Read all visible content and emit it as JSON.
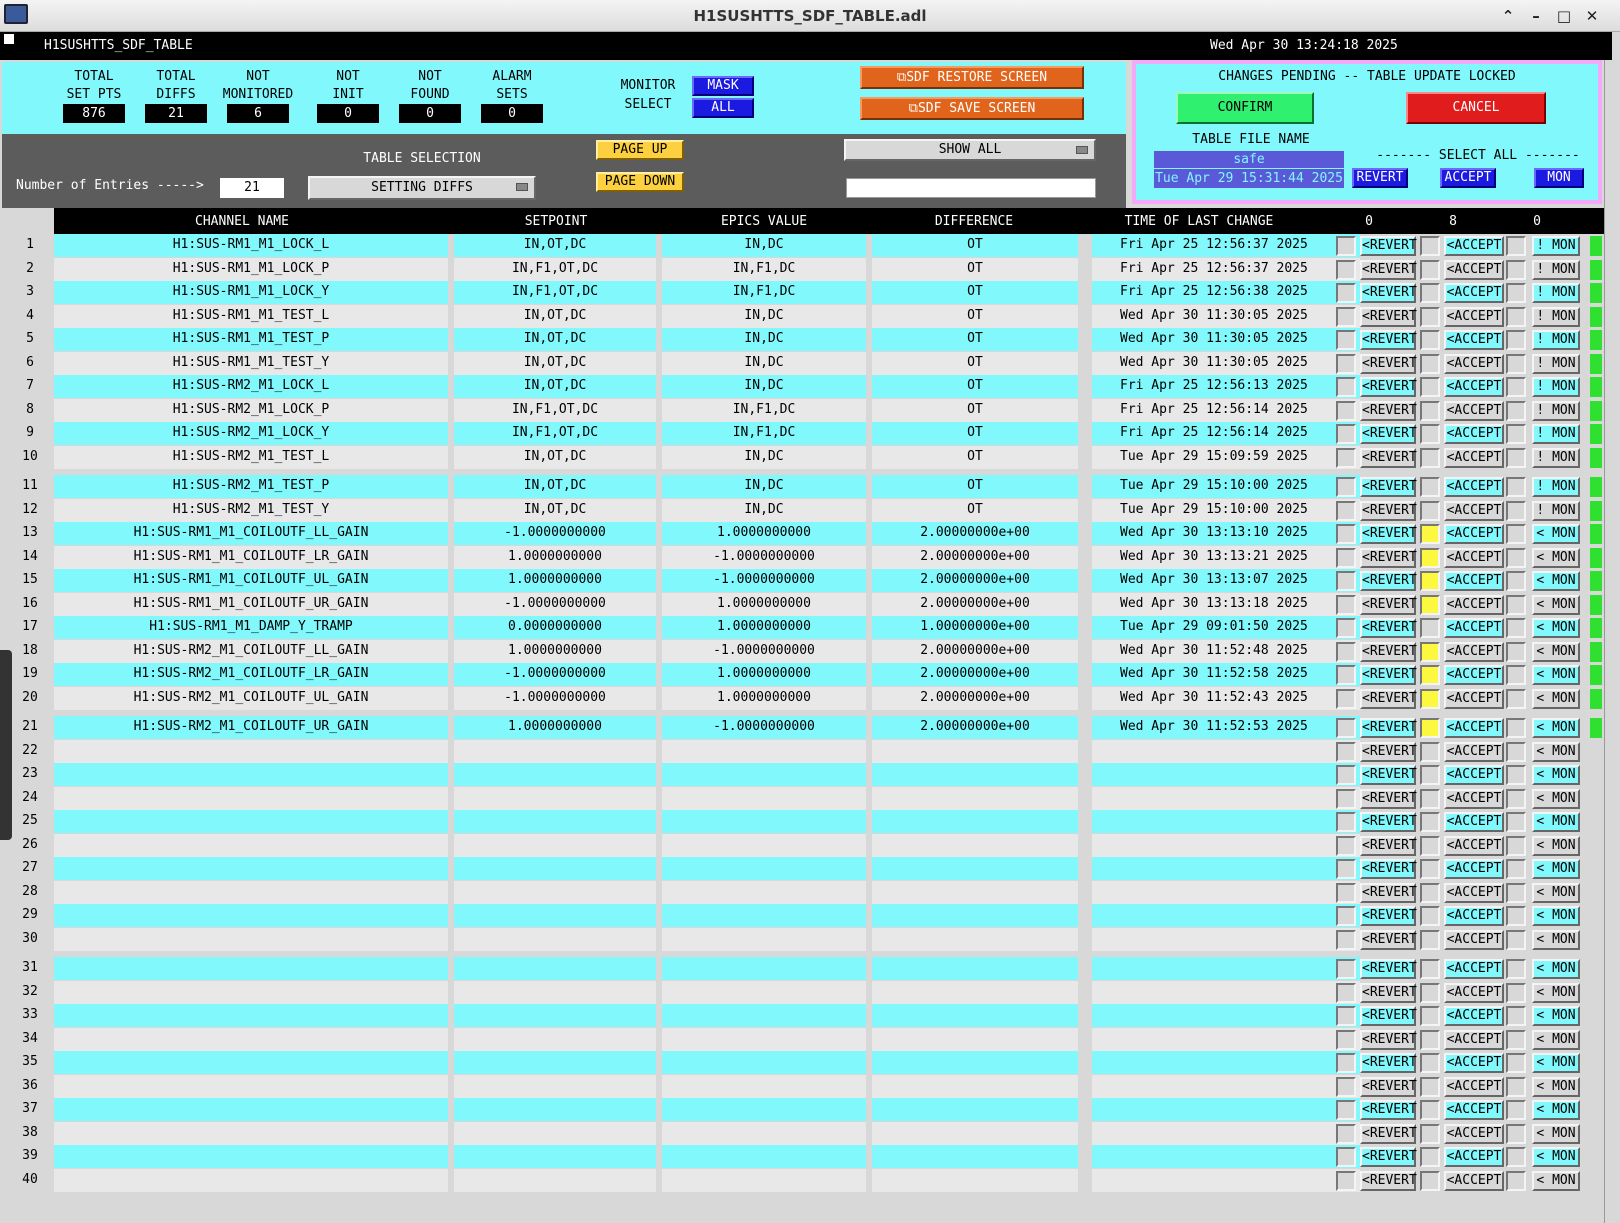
{
  "window": {
    "title": "H1SUSHTTS_SDF_TABLE.adl"
  },
  "header": {
    "screen_name": "H1SUSHTTS_SDF_TABLE",
    "timestamp": "Wed Apr 30 13:24:18 2025"
  },
  "summary": {
    "stats": [
      {
        "label1": "TOTAL",
        "label2": "SET PTS",
        "value": "876"
      },
      {
        "label1": "TOTAL",
        "label2": "DIFFS",
        "value": "21"
      },
      {
        "label1": "NOT",
        "label2": "MONITORED",
        "value": "6"
      },
      {
        "label1": "NOT",
        "label2": "INIT",
        "value": "0"
      },
      {
        "label1": "NOT",
        "label2": "FOUND",
        "value": "0"
      },
      {
        "label1": "ALARM",
        "label2": "SETS",
        "value": "0"
      }
    ],
    "monitor_select_1": "MONITOR",
    "monitor_select_2": "SELECT",
    "mask_label": "MASK",
    "all_label": "ALL",
    "restore_label": "SDF RESTORE SCREEN",
    "save_label": "SDF SAVE SCREEN"
  },
  "pending": {
    "title": "CHANGES PENDING -- TABLE UPDATE LOCKED",
    "confirm": "CONFIRM",
    "cancel": "CANCEL",
    "file_name_label": "TABLE FILE NAME",
    "file_name": "safe",
    "file_date": "Tue Apr 29 15:31:44 2025",
    "select_all": "------- SELECT ALL -------",
    "revert": "REVERT",
    "accept": "ACCEPT",
    "mon": "MON"
  },
  "controls": {
    "table_selection_label": "TABLE SELECTION",
    "table_selection_value": "SETTING DIFFS",
    "entries_label": "Number of Entries ----->",
    "entries_value": "21",
    "page_up": "PAGE UP",
    "page_down": "PAGE DOWN",
    "show_all": "SHOW ALL",
    "filter_value": ""
  },
  "table": {
    "columns": {
      "channel": "CHANNEL NAME",
      "setpoint": "SETPOINT",
      "epics": "EPICS VALUE",
      "difference": "DIFFERENCE",
      "time": "TIME OF LAST CHANGE",
      "revert_count": "0",
      "accept_count": "8",
      "mon_count": "0"
    },
    "revert_label": "<REVERT",
    "accept_label": "<ACCEPT",
    "rows": [
      {
        "n": "1",
        "channel": "H1:SUS-RM1_M1_LOCK_L",
        "setpoint": "IN,OT,DC",
        "epics": "IN,DC",
        "diff": "OT",
        "time": "Fri Apr 25 12:56:37 2025",
        "accepted": false,
        "mon": "! MON"
      },
      {
        "n": "2",
        "channel": "H1:SUS-RM1_M1_LOCK_P",
        "setpoint": "IN,F1,OT,DC",
        "epics": "IN,F1,DC",
        "diff": "OT",
        "time": "Fri Apr 25 12:56:37 2025",
        "accepted": false,
        "mon": "! MON"
      },
      {
        "n": "3",
        "channel": "H1:SUS-RM1_M1_LOCK_Y",
        "setpoint": "IN,F1,OT,DC",
        "epics": "IN,F1,DC",
        "diff": "OT",
        "time": "Fri Apr 25 12:56:38 2025",
        "accepted": false,
        "mon": "! MON"
      },
      {
        "n": "4",
        "channel": "H1:SUS-RM1_M1_TEST_L",
        "setpoint": "IN,OT,DC",
        "epics": "IN,DC",
        "diff": "OT",
        "time": "Wed Apr 30 11:30:05 2025",
        "accepted": false,
        "mon": "! MON"
      },
      {
        "n": "5",
        "channel": "H1:SUS-RM1_M1_TEST_P",
        "setpoint": "IN,OT,DC",
        "epics": "IN,DC",
        "diff": "OT",
        "time": "Wed Apr 30 11:30:05 2025",
        "accepted": false,
        "mon": "! MON"
      },
      {
        "n": "6",
        "channel": "H1:SUS-RM1_M1_TEST_Y",
        "setpoint": "IN,OT,DC",
        "epics": "IN,DC",
        "diff": "OT",
        "time": "Wed Apr 30 11:30:05 2025",
        "accepted": false,
        "mon": "! MON"
      },
      {
        "n": "7",
        "channel": "H1:SUS-RM2_M1_LOCK_L",
        "setpoint": "IN,OT,DC",
        "epics": "IN,DC",
        "diff": "OT",
        "time": "Fri Apr 25 12:56:13 2025",
        "accepted": false,
        "mon": "! MON"
      },
      {
        "n": "8",
        "channel": "H1:SUS-RM2_M1_LOCK_P",
        "setpoint": "IN,F1,OT,DC",
        "epics": "IN,F1,DC",
        "diff": "OT",
        "time": "Fri Apr 25 12:56:14 2025",
        "accepted": false,
        "mon": "! MON"
      },
      {
        "n": "9",
        "channel": "H1:SUS-RM2_M1_LOCK_Y",
        "setpoint": "IN,F1,OT,DC",
        "epics": "IN,F1,DC",
        "diff": "OT",
        "time": "Fri Apr 25 12:56:14 2025",
        "accepted": false,
        "mon": "! MON"
      },
      {
        "n": "10",
        "channel": "H1:SUS-RM2_M1_TEST_L",
        "setpoint": "IN,OT,DC",
        "epics": "IN,DC",
        "diff": "OT",
        "time": "Tue Apr 29 15:09:59 2025",
        "accepted": false,
        "mon": "! MON"
      },
      {
        "n": "11",
        "channel": "H1:SUS-RM2_M1_TEST_P",
        "setpoint": "IN,OT,DC",
        "epics": "IN,DC",
        "diff": "OT",
        "time": "Tue Apr 29 15:10:00 2025",
        "accepted": false,
        "mon": "! MON"
      },
      {
        "n": "12",
        "channel": "H1:SUS-RM2_M1_TEST_Y",
        "setpoint": "IN,OT,DC",
        "epics": "IN,DC",
        "diff": "OT",
        "time": "Tue Apr 29 15:10:00 2025",
        "accepted": false,
        "mon": "! MON"
      },
      {
        "n": "13",
        "channel": "H1:SUS-RM1_M1_COILOUTF_LL_GAIN",
        "setpoint": "-1.0000000000",
        "epics": "1.0000000000",
        "diff": "2.00000000e+00",
        "time": "Wed Apr 30 13:13:10 2025",
        "accepted": true,
        "mon": "< MON"
      },
      {
        "n": "14",
        "channel": "H1:SUS-RM1_M1_COILOUTF_LR_GAIN",
        "setpoint": "1.0000000000",
        "epics": "-1.0000000000",
        "diff": "2.00000000e+00",
        "time": "Wed Apr 30 13:13:21 2025",
        "accepted": true,
        "mon": "< MON"
      },
      {
        "n": "15",
        "channel": "H1:SUS-RM1_M1_COILOUTF_UL_GAIN",
        "setpoint": "1.0000000000",
        "epics": "-1.0000000000",
        "diff": "2.00000000e+00",
        "time": "Wed Apr 30 13:13:07 2025",
        "accepted": true,
        "mon": "< MON"
      },
      {
        "n": "16",
        "channel": "H1:SUS-RM1_M1_COILOUTF_UR_GAIN",
        "setpoint": "-1.0000000000",
        "epics": "1.0000000000",
        "diff": "2.00000000e+00",
        "time": "Wed Apr 30 13:13:18 2025",
        "accepted": true,
        "mon": "< MON"
      },
      {
        "n": "17",
        "channel": "H1:SUS-RM1_M1_DAMP_Y_TRAMP",
        "setpoint": "0.0000000000",
        "epics": "1.0000000000",
        "diff": "1.00000000e+00",
        "time": "Tue Apr 29 09:01:50 2025",
        "accepted": false,
        "mon": "< MON"
      },
      {
        "n": "18",
        "channel": "H1:SUS-RM2_M1_COILOUTF_LL_GAIN",
        "setpoint": "1.0000000000",
        "epics": "-1.0000000000",
        "diff": "2.00000000e+00",
        "time": "Wed Apr 30 11:52:48 2025",
        "accepted": true,
        "mon": "< MON"
      },
      {
        "n": "19",
        "channel": "H1:SUS-RM2_M1_COILOUTF_LR_GAIN",
        "setpoint": "-1.0000000000",
        "epics": "1.0000000000",
        "diff": "2.00000000e+00",
        "time": "Wed Apr 30 11:52:58 2025",
        "accepted": true,
        "mon": "< MON"
      },
      {
        "n": "20",
        "channel": "H1:SUS-RM2_M1_COILOUTF_UL_GAIN",
        "setpoint": "-1.0000000000",
        "epics": "1.0000000000",
        "diff": "2.00000000e+00",
        "time": "Wed Apr 30 11:52:43 2025",
        "accepted": true,
        "mon": "< MON"
      },
      {
        "n": "21",
        "channel": "H1:SUS-RM2_M1_COILOUTF_UR_GAIN",
        "setpoint": "1.0000000000",
        "epics": "-1.0000000000",
        "diff": "2.00000000e+00",
        "time": "Wed Apr 30 11:52:53 2025",
        "accepted": true,
        "mon": "< MON"
      },
      {
        "n": "22",
        "channel": "",
        "setpoint": "",
        "epics": "",
        "diff": "",
        "time": "",
        "accepted": false,
        "mon": "< MON"
      },
      {
        "n": "23",
        "channel": "",
        "setpoint": "",
        "epics": "",
        "diff": "",
        "time": "",
        "accepted": false,
        "mon": "< MON"
      },
      {
        "n": "24",
        "channel": "",
        "setpoint": "",
        "epics": "",
        "diff": "",
        "time": "",
        "accepted": false,
        "mon": "< MON"
      },
      {
        "n": "25",
        "channel": "",
        "setpoint": "",
        "epics": "",
        "diff": "",
        "time": "",
        "accepted": false,
        "mon": "< MON"
      },
      {
        "n": "26",
        "channel": "",
        "setpoint": "",
        "epics": "",
        "diff": "",
        "time": "",
        "accepted": false,
        "mon": "< MON"
      },
      {
        "n": "27",
        "channel": "",
        "setpoint": "",
        "epics": "",
        "diff": "",
        "time": "",
        "accepted": false,
        "mon": "< MON"
      },
      {
        "n": "28",
        "channel": "",
        "setpoint": "",
        "epics": "",
        "diff": "",
        "time": "",
        "accepted": false,
        "mon": "< MON"
      },
      {
        "n": "29",
        "channel": "",
        "setpoint": "",
        "epics": "",
        "diff": "",
        "time": "",
        "accepted": false,
        "mon": "< MON"
      },
      {
        "n": "30",
        "channel": "",
        "setpoint": "",
        "epics": "",
        "diff": "",
        "time": "",
        "accepted": false,
        "mon": "< MON"
      },
      {
        "n": "31",
        "channel": "",
        "setpoint": "",
        "epics": "",
        "diff": "",
        "time": "",
        "accepted": false,
        "mon": "< MON"
      },
      {
        "n": "32",
        "channel": "",
        "setpoint": "",
        "epics": "",
        "diff": "",
        "time": "",
        "accepted": false,
        "mon": "< MON"
      },
      {
        "n": "33",
        "channel": "",
        "setpoint": "",
        "epics": "",
        "diff": "",
        "time": "",
        "accepted": false,
        "mon": "< MON"
      },
      {
        "n": "34",
        "channel": "",
        "setpoint": "",
        "epics": "",
        "diff": "",
        "time": "",
        "accepted": false,
        "mon": "< MON"
      },
      {
        "n": "35",
        "channel": "",
        "setpoint": "",
        "epics": "",
        "diff": "",
        "time": "",
        "accepted": false,
        "mon": "< MON"
      },
      {
        "n": "36",
        "channel": "",
        "setpoint": "",
        "epics": "",
        "diff": "",
        "time": "",
        "accepted": false,
        "mon": "< MON"
      },
      {
        "n": "37",
        "channel": "",
        "setpoint": "",
        "epics": "",
        "diff": "",
        "time": "",
        "accepted": false,
        "mon": "< MON"
      },
      {
        "n": "38",
        "channel": "",
        "setpoint": "",
        "epics": "",
        "diff": "",
        "time": "",
        "accepted": false,
        "mon": "< MON"
      },
      {
        "n": "39",
        "channel": "",
        "setpoint": "",
        "epics": "",
        "diff": "",
        "time": "",
        "accepted": false,
        "mon": "< MON"
      },
      {
        "n": "40",
        "channel": "",
        "setpoint": "",
        "epics": "",
        "diff": "",
        "time": "",
        "accepted": false,
        "mon": "< MON"
      }
    ]
  },
  "colors": {
    "cyan": "#80f8fc",
    "gray": "#d8d8d8",
    "orange": "#e0641c",
    "blue": "#1a1ae0",
    "confirm": "#30f070",
    "cancel": "#e01c1c",
    "accepted": "#fcf840",
    "monitor_ok": "#30e030"
  }
}
